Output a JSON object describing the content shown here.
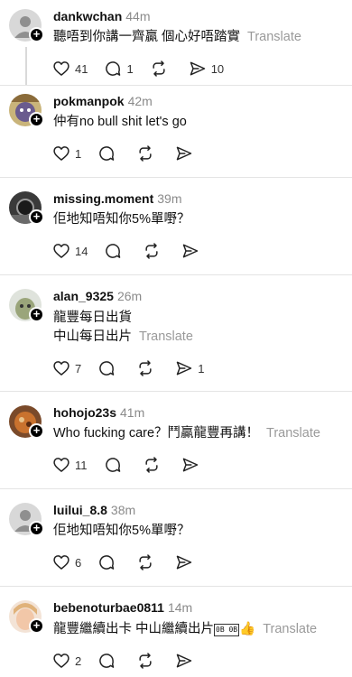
{
  "labels": {
    "translate": "Translate"
  },
  "posts": [
    {
      "username": "dankwchan",
      "time": "44m",
      "text": "聽唔到你講一齊贏 個心好唔踏實",
      "likes": "41",
      "replies": "1",
      "reposts": "",
      "shares": "10"
    },
    {
      "username": "pokmanpok",
      "time": "42m",
      "text": "仲有no bull shit let's go",
      "likes": "1",
      "replies": "",
      "reposts": "",
      "shares": ""
    },
    {
      "username": "missing.moment",
      "time": "39m",
      "text": "佢地知唔知你5%單嘢？",
      "likes": "14",
      "replies": "",
      "reposts": "",
      "shares": ""
    },
    {
      "username": "alan_9325",
      "time": "26m",
      "text_line1": "龍豐每日出貨",
      "text_line2": "中山每日出片",
      "likes": "7",
      "replies": "",
      "reposts": "",
      "shares": "1"
    },
    {
      "username": "hohojo23s",
      "time": "41m",
      "text": "Who fucking care？鬥贏龍豐再講！",
      "likes": "11",
      "replies": "",
      "reposts": "",
      "shares": ""
    },
    {
      "username": "luilui_8.8",
      "time": "38m",
      "text": "佢地知唔知你5%單嘢？",
      "likes": "6",
      "replies": "",
      "reposts": "",
      "shares": ""
    },
    {
      "username": "bebenoturbae0811",
      "time": "14m",
      "text": "龍豐繼續出卡 中山繼續出片",
      "emoji_box": "0B 0B",
      "emoji_tail": "👍",
      "likes": "2",
      "replies": "",
      "reposts": "",
      "shares": ""
    }
  ]
}
